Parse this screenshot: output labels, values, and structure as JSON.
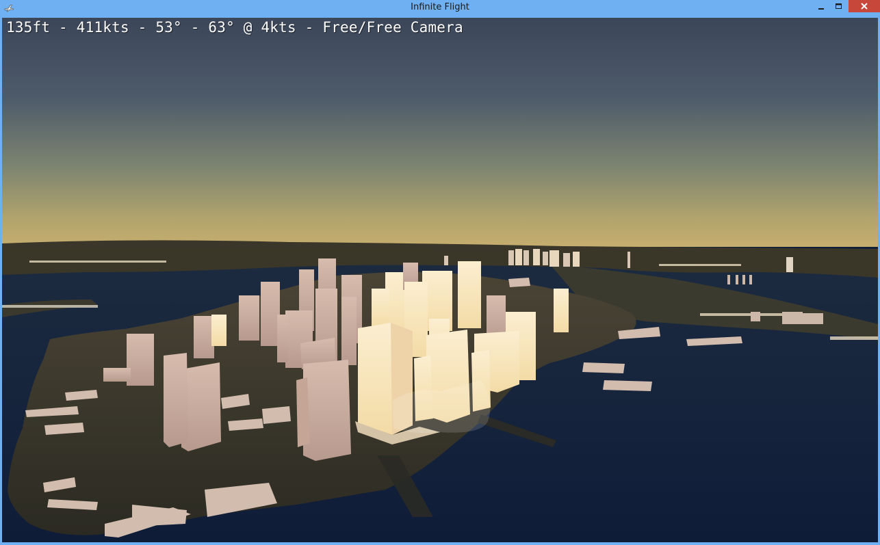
{
  "window": {
    "title": "Infinite Flight",
    "icon": "app-plane-icon",
    "controls": [
      "minimize-icon",
      "maximize-icon",
      "close-icon"
    ],
    "frame_color": "#6fb0f2",
    "close_color": "#c7473a"
  },
  "hud": {
    "text": "135ft - 411kts - 53° - 63° @ 4kts - Free/Free Camera"
  },
  "scene": {
    "sky_top": "#3e4b5e",
    "sky_horizon": "#c2ad70",
    "water": "#13223f",
    "land": "#2a2820",
    "building_lit": "#f6e3b4",
    "building_shade": "#c9aa9a"
  }
}
